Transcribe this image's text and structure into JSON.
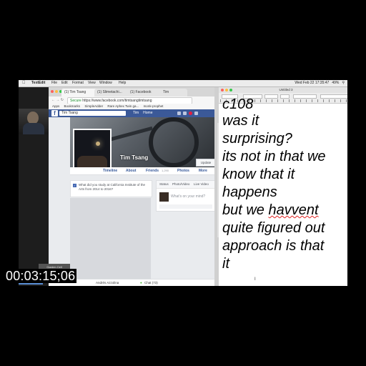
{
  "menubar": {
    "app": "TextEdit",
    "items": [
      "File",
      "Edit",
      "Format",
      "View",
      "Window",
      "Help"
    ],
    "datetime": "Wed Feb 22  17:35:47",
    "battery": "49%"
  },
  "browser": {
    "tabs": [
      "(1) Tim Tsang",
      "(1) Slimetachi...",
      "(1) Facebook",
      "Tim"
    ],
    "url_secure": "Secure",
    "url": "https://www.facebook.com/timtsangtimtsang",
    "bookmarks": [
      "Apps",
      "Bookmarks",
      "SimpleAdder",
      "Rare Aphex Twin ga...",
      "monk-prophet"
    ],
    "fb_search": "Tim Tsang",
    "fb_user": "Tim",
    "fb_home": "Home",
    "profile_name": "Tim Tsang",
    "update_info": "Update",
    "profile_nav": [
      "Timeline",
      "About",
      "Friends",
      "Photos",
      "More"
    ],
    "friends_count": "1,290",
    "question": "What did you study at California Institute of the Arts from 2014 to 2016?",
    "composer_tabs": [
      "Status",
      "Photo/Video",
      "Live Video"
    ],
    "composer_placeholder": "What's on your mind?",
    "bottom_left": "Andrés Azzolina",
    "chat_label": "Chat (73)"
  },
  "caption_label": "Garden Cell",
  "textedit": {
    "title": "Untitled 3",
    "lines": [
      "c108",
      "was it",
      "surprising?",
      "its not in that we",
      "know that it",
      "happens",
      "but we havvent",
      "quite figured out",
      "approach is that",
      "it"
    ],
    "misspelled_word": "havvent"
  },
  "timecode": "00:03:15;06"
}
